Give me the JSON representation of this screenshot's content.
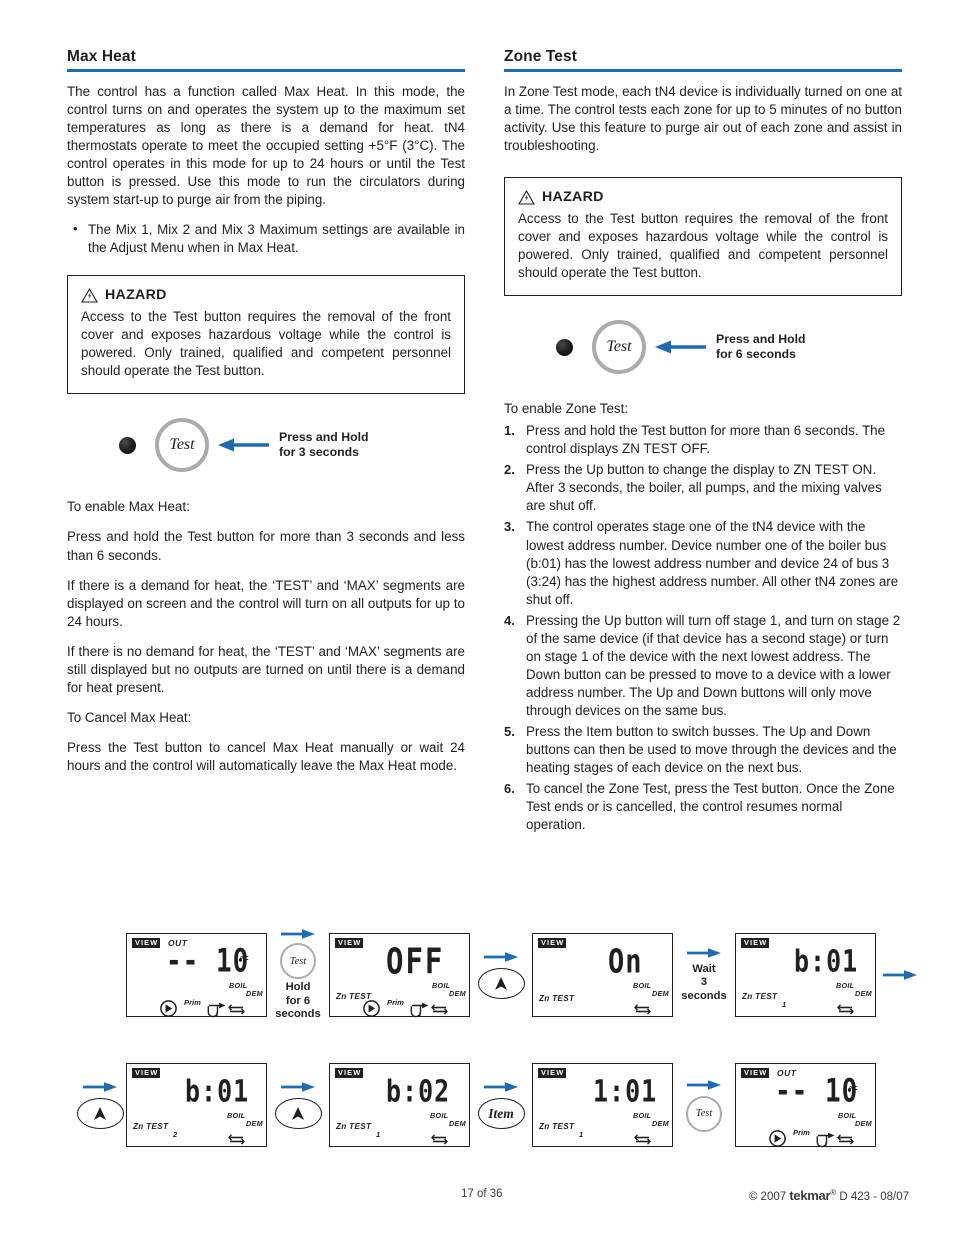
{
  "left_column": {
    "title": "Max Heat",
    "paragraphs": [
      "The control has a function called Max Heat. In this mode, the control turns on and operates the system up to the maximum set temperatures as long as there is a demand for heat. tN4 thermostats operate to meet the occupied setting +5°F (3°C). The control operates in this mode for up to 24 hours or until the Test button is pressed. Use this mode to run the circulators during system start-up to purge air from the piping."
    ],
    "bullets": [
      "The Mix 1, Mix 2 and Mix 3 Maximum settings are available in the Adjust Menu when in Max Heat."
    ],
    "hazard": {
      "label": "HAZARD",
      "text": "Access to the Test button requires the removal of the front cover and exposes hazardous voltage while the control is powered. Only trained, qualified and competent personnel should operate the Test button."
    },
    "test_button": {
      "button_label": "Test",
      "callout_line1": "Press and Hold",
      "callout_line2": "for 3 seconds"
    },
    "steps": [
      "To enable Max Heat:",
      "Press and hold the Test button for more than 3 seconds and less than 6 seconds.",
      "If there is a demand for heat, the ‘TEST’ and ‘MAX’ segments are displayed on screen and the control will turn on all outputs for up to 24 hours.",
      "If there is no demand for heat, the ‘TEST’ and ‘MAX’ segments are still displayed but no outputs are turned on until there is a demand for heat present.",
      "To Cancel Max Heat:",
      "Press the Test button to cancel Max Heat manually or wait 24 hours and the control will automatically leave the Max Heat mode."
    ]
  },
  "right_column": {
    "title": "Zone Test",
    "intro": "In Zone Test mode, each tN4 device is individually turned on one at a time. The control tests each zone for up to 5 minutes of no button activity. Use this feature to purge air out of each zone and assist in troubleshooting.",
    "hazard": {
      "label": "HAZARD",
      "text": "Access to the Test button requires the removal of the front cover and exposes hazardous voltage while the control is powered. Only trained, qualified and competent personnel should operate the Test button."
    },
    "test_button": {
      "button_label": "Test",
      "callout_line1": "Press and Hold",
      "callout_line2": "for 6 seconds"
    },
    "enable_lead": "To enable Zone Test:",
    "steps": [
      "Press and hold the Test button for more than 6 seconds. The control displays ZN TEST OFF.",
      "Press the Up button to change the display to ZN TEST ON. After 3 seconds, the boiler, all pumps, and the mixing valves are shut off.",
      "The control operates stage one of the tN4 device with the lowest address number. Device number one of the boiler bus (b:01) has the lowest address number and device 24 of bus 3 (3:24) has the highest address number. All other tN4 zones are shut off.",
      "Pressing the Up button will turn off stage 1, and turn on stage 2 of the same device (if that device has a second stage) or turn on stage 1 of the device with the next lowest address. The Down button can be pressed to move to a device with a lower address number. The Up and Down buttons will only move through devices on the same bus.",
      "Press the Item button to switch busses. The Up and Down buttons can then be used to move through the devices and the heating stages of each device on the next bus.",
      "To cancel the Zone Test, press the Test button. Once the Zone Test ends or is cancelled, the control resumes normal operation."
    ]
  },
  "flow_diagram": {
    "row1": {
      "screens": [
        {
          "view": "VIEW",
          "out": "OUT",
          "main": "-- 10",
          "degree": "°F",
          "boil": "BOIL",
          "dem": "DEM",
          "zn_test": "",
          "stage": "",
          "prim": "Prim",
          "has_pump": true,
          "has_valve": true
        },
        {
          "view": "VIEW",
          "out": "",
          "main": "OFF",
          "degree": "",
          "boil": "BOIL",
          "dem": "DEM",
          "zn_test": "Zn TEST",
          "stage": "",
          "prim": "Prim",
          "has_pump": true,
          "has_valve": true
        },
        {
          "view": "VIEW",
          "out": "",
          "main": "On",
          "degree": "",
          "boil": "BOIL",
          "dem": "DEM",
          "zn_test": "Zn TEST",
          "stage": "",
          "prim": "",
          "has_pump": false,
          "has_valve": false
        },
        {
          "view": "VIEW",
          "out": "",
          "main": "b:01",
          "degree": "",
          "boil": "BOIL",
          "dem": "DEM",
          "zn_test": "Zn TEST",
          "stage": "1",
          "prim": "",
          "has_pump": false,
          "has_valve": false
        }
      ],
      "connectors": [
        {
          "type": "test",
          "label": "Test",
          "caption": "Hold\nfor 6\nseconds"
        },
        {
          "type": "up",
          "label": "",
          "caption": ""
        },
        {
          "type": "up",
          "label": "",
          "caption": "Wait\n3\nseconds"
        }
      ]
    },
    "row2": {
      "screens": [
        {
          "view": "VIEW",
          "out": "",
          "main": "b:01",
          "degree": "",
          "boil": "BOIL",
          "dem": "DEM",
          "zn_test": "Zn TEST",
          "stage": "2",
          "prim": "",
          "has_pump": false,
          "has_valve": false
        },
        {
          "view": "VIEW",
          "out": "",
          "main": "b:02",
          "degree": "",
          "boil": "BOIL",
          "dem": "DEM",
          "zn_test": "Zn TEST",
          "stage": "1",
          "prim": "",
          "has_pump": false,
          "has_valve": false
        },
        {
          "view": "VIEW",
          "out": "",
          "main": "1:01",
          "degree": "",
          "boil": "BOIL",
          "dem": "DEM",
          "zn_test": "Zn TEST",
          "stage": "1",
          "prim": "",
          "has_pump": false,
          "has_valve": false
        },
        {
          "view": "VIEW",
          "out": "OUT",
          "main": "-- 10",
          "degree": "°F",
          "boil": "BOIL",
          "dem": "DEM",
          "zn_test": "",
          "stage": "",
          "prim": "Prim",
          "has_pump": true,
          "has_valve": true
        }
      ],
      "connectors": [
        {
          "type": "up",
          "label": "",
          "caption": ""
        },
        {
          "type": "up",
          "label": "",
          "caption": ""
        },
        {
          "type": "item",
          "label": "Item",
          "caption": ""
        },
        {
          "type": "test-small",
          "label": "Test",
          "caption": ""
        }
      ]
    }
  },
  "footer": {
    "page_number": "17 of 36",
    "copyright": "© 2007",
    "brand": "tekmar",
    "brand_mark": "®",
    "document": "D 423 - 08/07"
  },
  "colors": {
    "accent_blue": "#1b6cb5",
    "text": "#231f20",
    "ring_gray": "#a9abae"
  }
}
